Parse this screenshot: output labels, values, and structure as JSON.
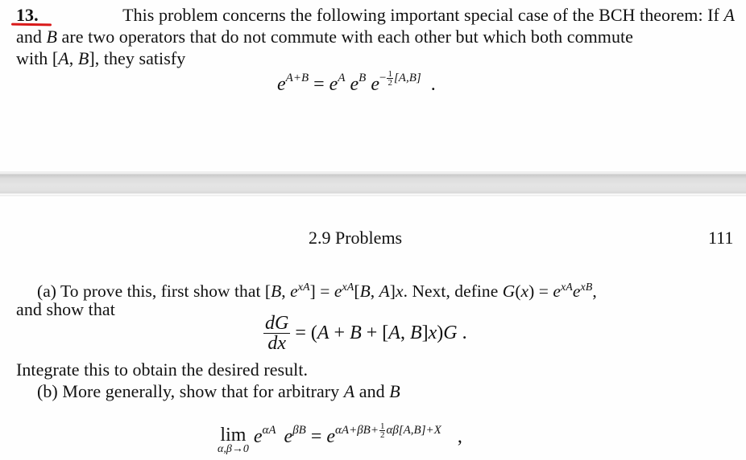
{
  "top_page": {
    "problem_number": "13.",
    "intro_lines": [
      [
        "This problem concerns the following important special case of the BCH theorem: If ",
        "A"
      ],
      [
        "and ",
        "B",
        " are two operators that do not commute with each other but which both commute"
      ],
      [
        "with [",
        "A",
        ", ",
        "B",
        "], they satisfy"
      ]
    ],
    "intro": {
      "line1_text": "This problem concerns the following important special case of the BCH theorem: If",
      "line1_var": "A",
      "line2_a": "and",
      "line2_var": "B",
      "line2_b": "are two operators that do not commute with each other but which both commute",
      "line3_a": "with [",
      "line3_var1": "A",
      "line3_comma": ", ",
      "line3_var2": "B",
      "line3_b": "], they satisfy"
    },
    "equation": {
      "lhs_base": "e",
      "lhs_exp": "A+B",
      "equals": "=",
      "f1_base": "e",
      "f1_exp": "A",
      "f2_base": "e",
      "f2_exp": "B",
      "f3_base": "e",
      "f3_exp_sign": "−",
      "f3_frac_num": "1",
      "f3_frac_den": "2",
      "f3_exp_rest": "[A,B]",
      "end": "."
    },
    "annotation": {
      "underline_color": "#d91a1a",
      "target": "problem_number"
    }
  },
  "bottom_page": {
    "running_head": "2.9 Problems",
    "page_number": "111",
    "part_a": {
      "line1": {
        "t1": "(a) To prove this, first show that [",
        "v_B": "B",
        "t_comma": ", ",
        "e1": "e",
        "e1_exp": "xA",
        "t2": "] = ",
        "e2": "e",
        "e2_exp": "xA",
        "t3": "[",
        "v_B2": "B",
        "t4": ", ",
        "v_A": "A",
        "t5": "]",
        "v_x": "x",
        "t6": ". Next, define ",
        "v_G": "G",
        "t7": "(",
        "v_x2": "x",
        "t8": ") = ",
        "e3": "e",
        "e3_exp": "xA",
        "e4": "e",
        "e4_exp": "xB",
        "t9": ","
      },
      "line2": "and show that",
      "equation": {
        "frac_num": "dG",
        "frac_den": "dx",
        "rhs": "= (A + B + [A, B]x)G .",
        "rhs_parts": [
          "= (",
          "A",
          " + ",
          "B",
          " + [",
          "A",
          ", ",
          "B",
          "]",
          "x",
          ")",
          "G",
          " ."
        ]
      },
      "line3": "Integrate this to obtain the desired result."
    },
    "part_b": {
      "line1_text": "(b) More generally, show that for arbitrary ",
      "var1": "A",
      "and": " and ",
      "var2": "B",
      "equation": {
        "lim_word": "lim",
        "lim_sub": "α,β→0",
        "f1_base": "e",
        "f1_exp": "αA",
        "f2_base": "e",
        "f2_exp": "βB",
        "equals": "=",
        "rhs_base": "e",
        "rhs_exp_a": "αA+βB+",
        "rhs_frac_num": "1",
        "rhs_frac_den": "2",
        "rhs_exp_b": "αβ[A,B]+X",
        "end": ","
      }
    }
  }
}
